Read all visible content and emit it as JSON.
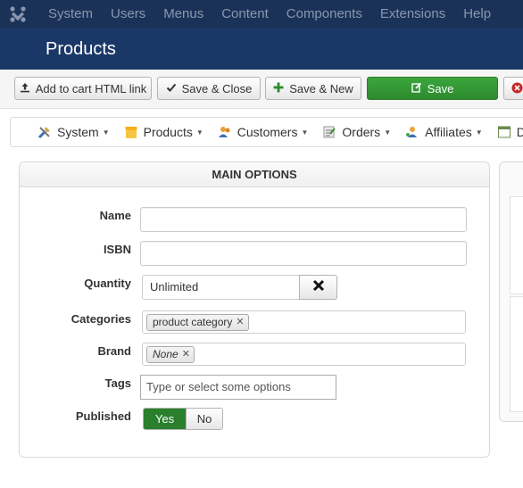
{
  "topmenu": {
    "items": [
      "System",
      "Users",
      "Menus",
      "Content",
      "Components",
      "Extensions",
      "Help"
    ]
  },
  "title": "Products",
  "toolbar": {
    "add_to_cart": "Add to cart HTML link",
    "save_close": "Save & Close",
    "save_new": "Save & New",
    "save": "Save"
  },
  "compnav": {
    "items": [
      "System",
      "Products",
      "Customers",
      "Orders",
      "Affiliates",
      "D"
    ]
  },
  "panel": {
    "heading": "MAIN OPTIONS",
    "fields": {
      "name_label": "Name",
      "name_value": "",
      "isbn_label": "ISBN",
      "isbn_value": "",
      "quantity_label": "Quantity",
      "quantity_value": "Unlimited",
      "categories_label": "Categories",
      "categories_chip": "product category",
      "brand_label": "Brand",
      "brand_chip": "None",
      "tags_label": "Tags",
      "tags_placeholder": "Type or select some options",
      "published_label": "Published",
      "published_yes": "Yes",
      "published_no": "No",
      "published_selected": "Yes"
    }
  },
  "colors": {
    "topbar": "#1b3258",
    "titlebar": "#1a3867",
    "save_green": "#2d8a2e",
    "toggle_on": "#2a7f2c"
  }
}
